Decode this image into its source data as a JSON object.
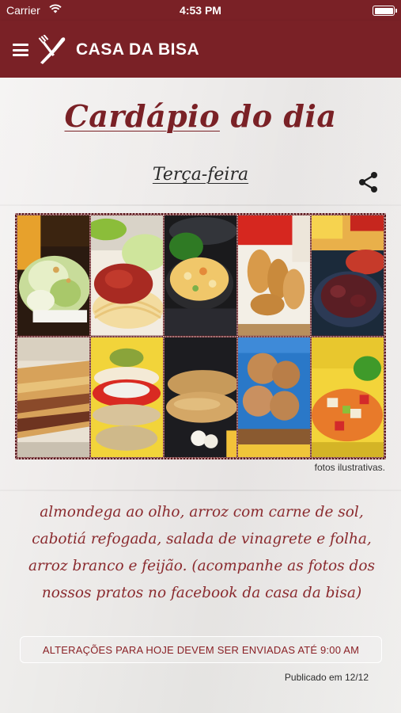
{
  "status_bar": {
    "carrier": "Carrier",
    "time": "4:53 PM",
    "wifi_icon": "wifi-icon",
    "battery_icon": "battery-icon"
  },
  "header": {
    "title": "CASA DA BISA",
    "menu_icon": "hamburger-menu-icon",
    "logo_icon": "fork-knife-logo-icon",
    "background_color": "#7a2126"
  },
  "main": {
    "title_part1": "Cardápio",
    "title_part2": " do dia",
    "day": "Terça-feira",
    "share_icon": "share-icon",
    "photos": [
      {
        "subject": "salada verde"
      },
      {
        "subject": "espaguete ao molho"
      },
      {
        "subject": "salada de batata"
      },
      {
        "subject": "pastéis"
      },
      {
        "subject": "carne com legumes"
      },
      {
        "subject": "lasanha"
      },
      {
        "subject": "sanduíche com tomate"
      },
      {
        "subject": "bife à milanesa"
      },
      {
        "subject": "bolinhos fritos"
      },
      {
        "subject": "salada colorida"
      }
    ],
    "photos_caption": "fotos ilustrativas.",
    "description": "almondega ao olho, arroz com carne de sol, cabotiá refogada, salada de vinagrete e folha, arroz branco e feijão. (acompanhe as fotos dos nossos pratos no facebook da casa da bisa)",
    "notice": "ALTERAÇÕES PARA HOJE DEVEM SER ENVIADAS ATÉ 9:00 AM",
    "published": "Publicado em 12/12",
    "accent_color": "#7a2126"
  }
}
